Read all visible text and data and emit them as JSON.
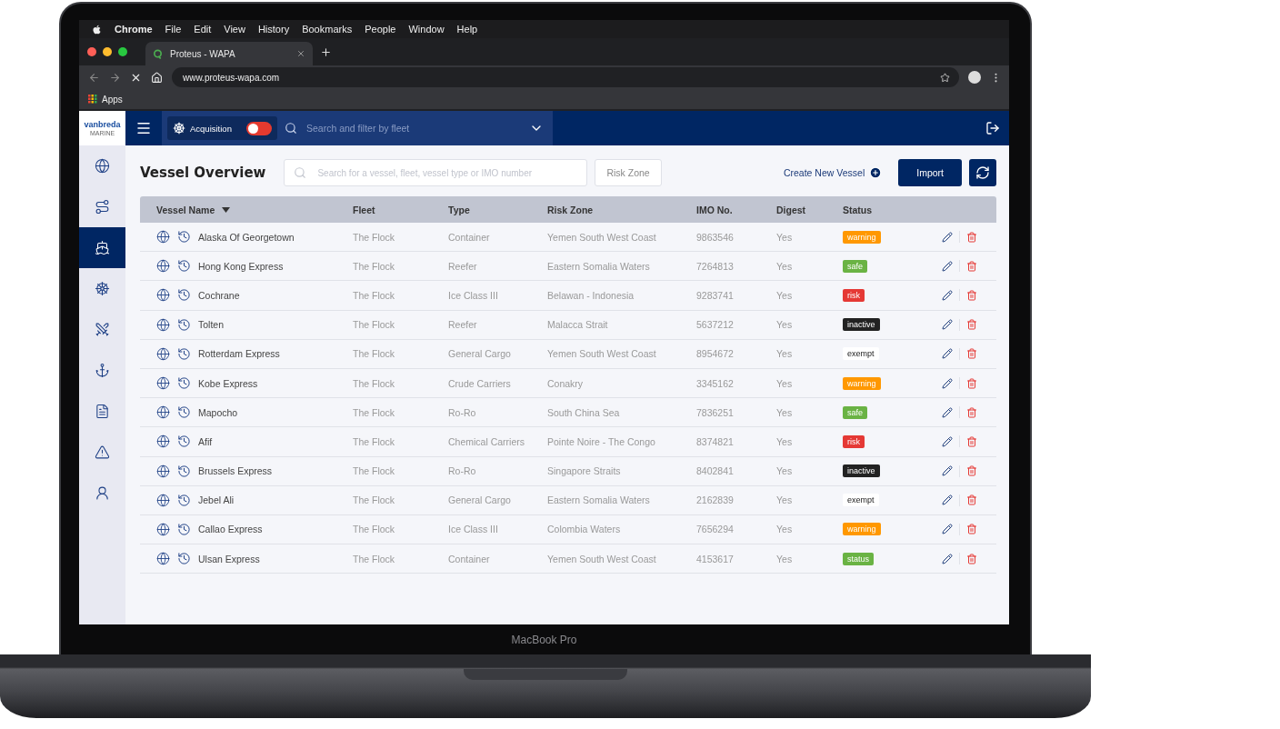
{
  "menubar": {
    "app_name": "Chrome",
    "items": [
      "File",
      "Edit",
      "View",
      "History",
      "Bookmarks",
      "People",
      "Window",
      "Help"
    ]
  },
  "browser": {
    "tabs": [
      {
        "title": "Proteus - WAPA",
        "selected": true
      }
    ],
    "url": "www.proteus-wapa.com",
    "bookmarks": [
      "Apps"
    ]
  },
  "app_header": {
    "logo": {
      "name": "vanbreda",
      "tagline": "MARINE"
    },
    "mode": {
      "label": "Acquisition",
      "on": false
    },
    "fleet_search": {
      "placeholder": "Search and filter by fleet"
    }
  },
  "sidebar": {
    "items": [
      {
        "selected": false
      },
      {
        "selected": false
      },
      {
        "selected": true
      },
      {
        "selected": false
      },
      {
        "selected": false
      },
      {
        "selected": false
      },
      {
        "selected": false
      },
      {
        "selected": false
      },
      {
        "selected": false
      }
    ]
  },
  "page": {
    "title": "Vessel Overview",
    "search": {
      "placeholder": "Search for a vessel, fleet, vessel type or IMO number"
    },
    "filter_button": "Risk Zone",
    "create_link": "Create New Vessel",
    "import_button": "Import"
  },
  "table": {
    "columns": [
      {
        "label": "Vessel Name",
        "sorted": true
      },
      {
        "label": "Fleet",
        "sorted": false
      },
      {
        "label": "Type",
        "sorted": false
      },
      {
        "label": "Risk Zone",
        "sorted": false
      },
      {
        "label": "IMO No.",
        "sorted": false
      },
      {
        "label": "Digest",
        "sorted": false
      },
      {
        "label": "Status",
        "sorted": false
      }
    ],
    "rows": [
      {
        "name": "Alaska Of Georgetown",
        "fleet": "The Flock",
        "type": "Container",
        "risk_zone": "Yemen South West Coast",
        "imo": "9863546",
        "digest": "Yes",
        "status": {
          "label": "warning",
          "color": "#ff9800"
        }
      },
      {
        "name": "Hong Kong Express",
        "fleet": "The Flock",
        "type": "Reefer",
        "risk_zone": "Eastern Somalia Waters",
        "imo": "7264813",
        "digest": "Yes",
        "status": {
          "label": "safe",
          "color": "#6ab344"
        }
      },
      {
        "name": "Cochrane",
        "fleet": "The Flock",
        "type": "Ice Class III",
        "risk_zone": "Belawan - Indonesia",
        "imo": "9283741",
        "digest": "Yes",
        "status": {
          "label": "risk",
          "color": "#e53935"
        }
      },
      {
        "name": "Tolten",
        "fleet": "The Flock",
        "type": "Reefer",
        "risk_zone": "Malacca Strait",
        "imo": "5637212",
        "digest": "Yes",
        "status": {
          "label": "inactive",
          "color": "#222222"
        }
      },
      {
        "name": "Rotterdam Express",
        "fleet": "The Flock",
        "type": "General Cargo",
        "risk_zone": "Yemen South West Coast",
        "imo": "8954672",
        "digest": "Yes",
        "status": {
          "label": "exempt",
          "color": "#ffffff"
        }
      },
      {
        "name": "Kobe Express",
        "fleet": "The Flock",
        "type": "Crude Carriers",
        "risk_zone": "Conakry",
        "imo": "3345162",
        "digest": "Yes",
        "status": {
          "label": "warning",
          "color": "#ff9800"
        }
      },
      {
        "name": "Mapocho",
        "fleet": "The Flock",
        "type": "Ro-Ro",
        "risk_zone": "South China Sea",
        "imo": "7836251",
        "digest": "Yes",
        "status": {
          "label": "safe",
          "color": "#6ab344"
        }
      },
      {
        "name": "Afif",
        "fleet": "The Flock",
        "type": "Chemical Carriers",
        "risk_zone": "Pointe Noire - The Congo",
        "imo": "8374821",
        "digest": "Yes",
        "status": {
          "label": "risk",
          "color": "#e53935"
        }
      },
      {
        "name": "Brussels Express",
        "fleet": "The Flock",
        "type": "Ro-Ro",
        "risk_zone": "Singapore Straits",
        "imo": "8402841",
        "digest": "Yes",
        "status": {
          "label": "inactive",
          "color": "#222222"
        }
      },
      {
        "name": "Jebel Ali",
        "fleet": "The Flock",
        "type": "General Cargo",
        "risk_zone": "Eastern Somalia Waters",
        "imo": "2162839",
        "digest": "Yes",
        "status": {
          "label": "exempt",
          "color": "#ffffff"
        }
      },
      {
        "name": "Callao Express",
        "fleet": "The Flock",
        "type": "Ice Class III",
        "risk_zone": "Colombia Waters",
        "imo": "7656294",
        "digest": "Yes",
        "status": {
          "label": "warning",
          "color": "#ff9800"
        }
      },
      {
        "name": "Ulsan Express",
        "fleet": "The Flock",
        "type": "Container",
        "risk_zone": "Yemen South West Coast",
        "imo": "4153617",
        "digest": "Yes",
        "status": {
          "label": "status",
          "color": "#6ab344"
        }
      }
    ]
  },
  "device_label": "MacBook Pro"
}
